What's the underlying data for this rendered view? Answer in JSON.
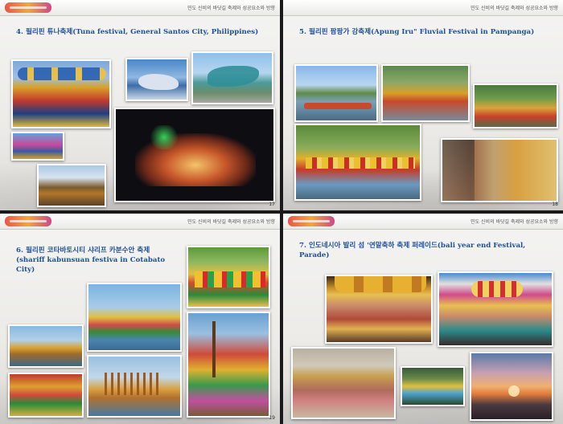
{
  "header_text": "민도 신비의 바닷길 축제와 성공요소와 방향",
  "slides": [
    {
      "title": "4. 필리핀 튜나축제(Tuna festival, General Santos City, Philippines)",
      "page": "17",
      "photos": [
        "tuna-dancers-photo",
        "tuna-float-water-photo",
        "tuna-float-fish-photo",
        "tuna-crowd-photo",
        "tuna-boat-float-photo",
        "tuna-night-float-photo"
      ]
    },
    {
      "title": "5. 필리핀 팜팡가 강축제(Apung Iru\" Fluvial Festival in Pampanga)",
      "page": "18",
      "photos": [
        "river-boats-photo",
        "river-decorated-boat-photo",
        "river-crowd-boat-photo",
        "river-fluvial-parade-photo",
        "river-spectators-photo"
      ]
    },
    {
      "title": "6. 필리핀 코타바토시티 샤리프 카분수안 축제",
      "subtitle": "(shariff kabunsuan festiva in Cotabato City)",
      "page": "19",
      "photos": [
        "cotabato-costumes-photo",
        "cotabato-boat-flags-photo",
        "cotabato-tall-boat-photo",
        "cotabato-river-float-photo",
        "cotabato-wooden-boat-photo",
        "cotabato-performers-photo"
      ]
    },
    {
      "title": "7. 인도네시아 발리 섬 '연말축하 축제 퍼레이드(bali year end Festival, Parade)",
      "page": "",
      "photos": [
        "bali-dancers-photo",
        "bali-headdress-photo",
        "bali-beach-procession-photo",
        "bali-group-dance-photo",
        "bali-sunset-beach-photo"
      ]
    }
  ]
}
